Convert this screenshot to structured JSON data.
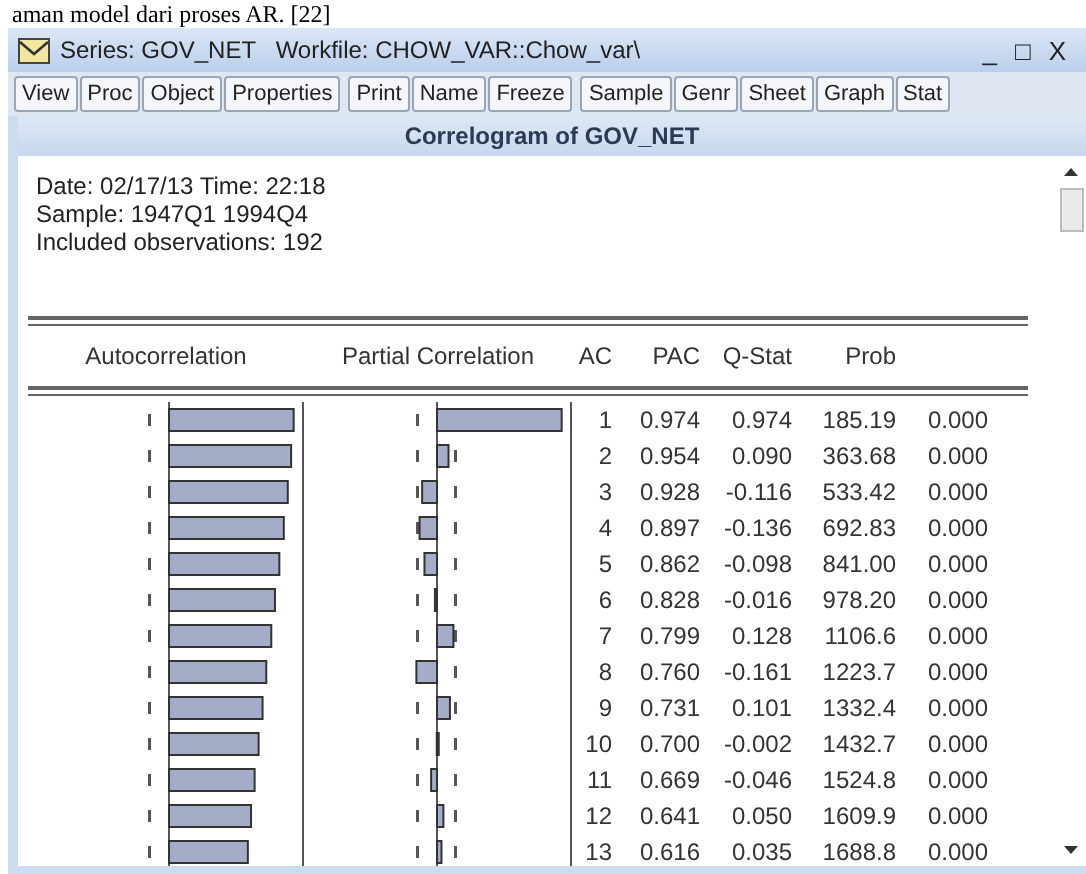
{
  "document_text": "aman model dari proses AR. [22]",
  "window": {
    "title": "Series: GOV_NET   Workfile: CHOW_VAR::Chow_var\\",
    "controls": [
      "_",
      "□",
      "X"
    ]
  },
  "toolbar": [
    [
      "View",
      "Proc",
      "Object",
      "Properties"
    ],
    [
      "Print",
      "Name",
      "Freeze"
    ],
    [
      "Sample",
      "Genr",
      "Sheet",
      "Graph",
      "Stat"
    ]
  ],
  "view_title": "Correlogram of GOV_NET",
  "info": [
    "Date: 02/17/13   Time: 22:18",
    "Sample: 1947Q1 1994Q4",
    "Included observations: 192"
  ],
  "table": {
    "columns": [
      "Autocorrelation",
      "Partial Correlation",
      "AC",
      "PAC",
      "Q-Stat",
      "Prob"
    ],
    "rows": [
      {
        "lag": "1",
        "ac": "0.974",
        "pac": "0.974",
        "q": "185.19",
        "prob": "0.000"
      },
      {
        "lag": "2",
        "ac": "0.954",
        "pac": "0.090",
        "q": "363.68",
        "prob": "0.000"
      },
      {
        "lag": "3",
        "ac": "0.928",
        "pac": "-0.116",
        "q": "533.42",
        "prob": "0.000"
      },
      {
        "lag": "4",
        "ac": "0.897",
        "pac": "-0.136",
        "q": "692.83",
        "prob": "0.000"
      },
      {
        "lag": "5",
        "ac": "0.862",
        "pac": "-0.098",
        "q": "841.00",
        "prob": "0.000"
      },
      {
        "lag": "6",
        "ac": "0.828",
        "pac": "-0.016",
        "q": "978.20",
        "prob": "0.000"
      },
      {
        "lag": "7",
        "ac": "0.799",
        "pac": "0.128",
        "q": "1106.6",
        "prob": "0.000"
      },
      {
        "lag": "8",
        "ac": "0.760",
        "pac": "-0.161",
        "q": "1223.7",
        "prob": "0.000"
      },
      {
        "lag": "9",
        "ac": "0.731",
        "pac": "0.101",
        "q": "1332.4",
        "prob": "0.000"
      },
      {
        "lag": "10",
        "ac": "0.700",
        "pac": "-0.002",
        "q": "1432.7",
        "prob": "0.000"
      },
      {
        "lag": "11",
        "ac": "0.669",
        "pac": "-0.046",
        "q": "1524.8",
        "prob": "0.000"
      },
      {
        "lag": "12",
        "ac": "0.641",
        "pac": "0.050",
        "q": "1609.9",
        "prob": "0.000"
      },
      {
        "lag": "13",
        "ac": "0.616",
        "pac": "0.035",
        "q": "1688.8",
        "prob": "0.000"
      }
    ]
  }
}
